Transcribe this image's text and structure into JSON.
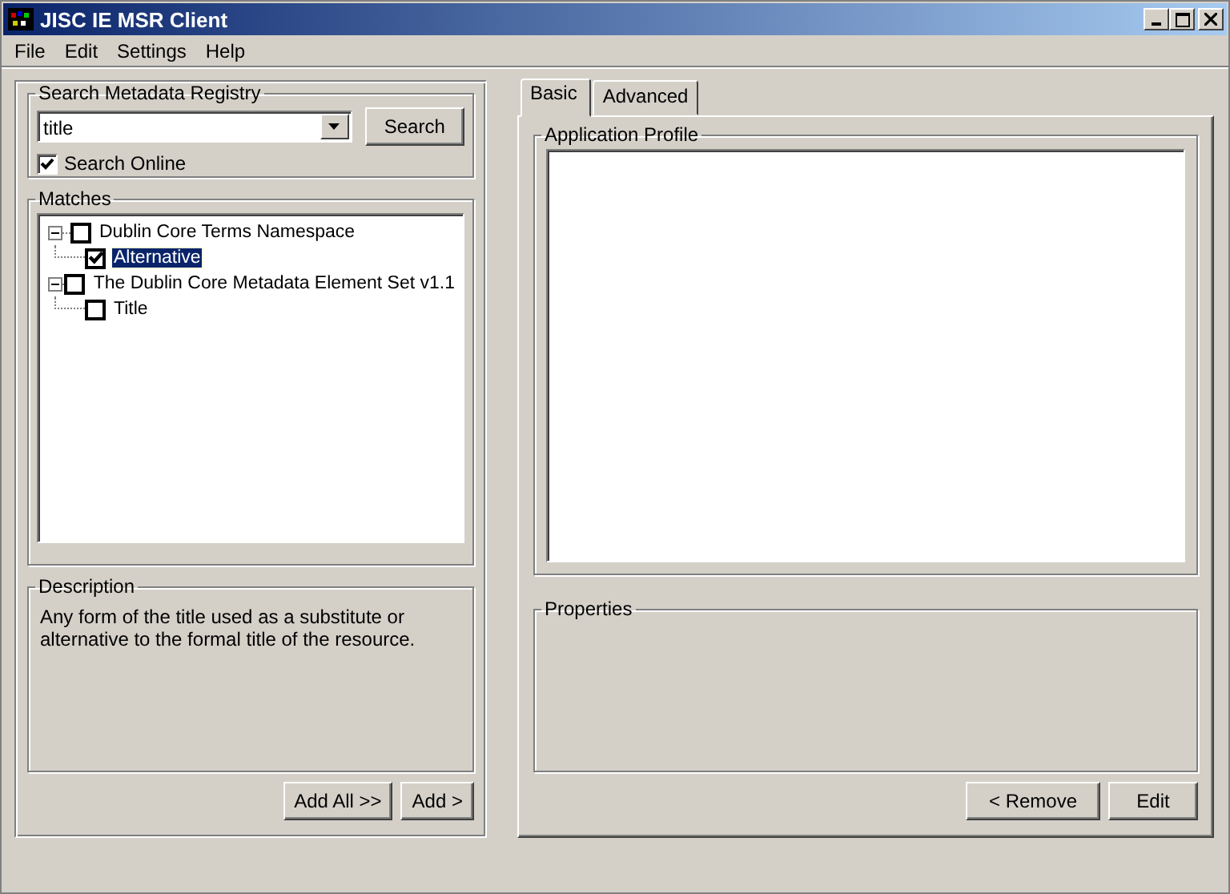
{
  "window": {
    "title": "JISC IE MSR Client"
  },
  "menu": [
    "File",
    "Edit",
    "Settings",
    "Help"
  ],
  "search_panel": {
    "title": "Search Metadata Registry",
    "query": "title",
    "search_button": "Search",
    "online": {
      "label": "Search Online",
      "checked": true
    }
  },
  "matches": {
    "title": "Matches",
    "tree": [
      {
        "label": "Dublin Core Terms Namespace",
        "checked": false,
        "selected": false,
        "expanded": true,
        "children": [
          {
            "label": "Alternative",
            "checked": true,
            "selected": true
          }
        ]
      },
      {
        "label": "The Dublin Core Metadata Element Set v1.1",
        "checked": false,
        "selected": false,
        "expanded": true,
        "children": [
          {
            "label": "Title",
            "checked": false,
            "selected": false
          }
        ]
      }
    ]
  },
  "description": {
    "title": "Description",
    "text": "Any form of the title used as a substitute or alternative to the formal title of the resource."
  },
  "left_buttons": [
    "Add All >>",
    "Add >"
  ],
  "tabs": [
    {
      "label": "Basic",
      "selected": true
    },
    {
      "label": "Advanced",
      "selected": false
    }
  ],
  "application_profile": {
    "title": "Application Profile"
  },
  "properties": {
    "title": "Properties"
  },
  "right_buttons": [
    "<  Remove",
    "Edit"
  ]
}
